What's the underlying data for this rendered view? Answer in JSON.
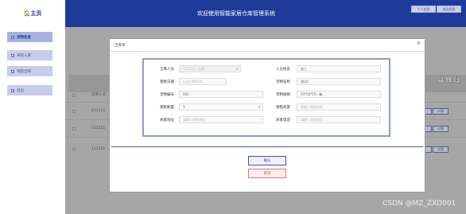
{
  "brand": {
    "logo_text": "🏠主页"
  },
  "header": {
    "title": "欢迎使用智能家居仓库管理系统",
    "btn_user": "个人信息",
    "btn_logout": "退出登录"
  },
  "sidebar": {
    "items": [
      {
        "label": "货物信息"
      },
      {
        "label": "采购入库"
      },
      {
        "label": "销售出库"
      },
      {
        "label": "退出"
      }
    ]
  },
  "background_table": {
    "column_header": "仓库人员",
    "rows": [
      {
        "cell": "111111"
      },
      {
        "cell": "111111"
      },
      {
        "cell": "111111"
      }
    ],
    "row_buttons": {
      "edit": "详情"
    }
  },
  "modal": {
    "title": "出库单",
    "close": "×",
    "fields": {
      "warehouse_staff": {
        "label": "仓库人员",
        "value": "111111 - 仓管"
      },
      "staff_name": {
        "label": "人员姓名",
        "value": "张三"
      },
      "sale_date": {
        "label": "销售日期",
        "placeholder": "yyyy-MM-dd"
      },
      "goods_name": {
        "label": "货物名称",
        "value": "测试1"
      },
      "goods_code": {
        "label": "货物编号",
        "value": "001"
      },
      "goods_spec": {
        "label": "货物规格",
        "value": "50*50*50—箱"
      },
      "sale_qty": {
        "label": "销售数量",
        "value": "1"
      },
      "sale_merchant": {
        "label": "销售商家",
        "placeholder": "请输入销售商家"
      },
      "merchant_address": {
        "label": "商家地址",
        "placeholder": "请输入商家地址"
      },
      "merchant_phone": {
        "label": "商家电话",
        "placeholder": "请输入商家电话"
      }
    },
    "confirm": "确认",
    "cancel": "取消"
  },
  "watermark": "CSDN @MZ_ZXD001",
  "colors": {
    "primary": "#1f3b9a",
    "accent": "#3f51b5",
    "danger": "#d9534f"
  }
}
